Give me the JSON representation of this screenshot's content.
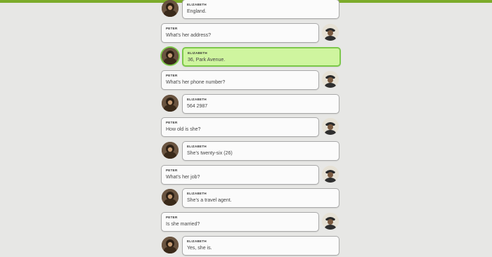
{
  "header": {
    "accent_color": "#7cab2a"
  },
  "dialogue": [
    {
      "speaker": "ELIZABETH",
      "text": "England.",
      "side": "left",
      "active": false
    },
    {
      "speaker": "PETER",
      "text": "What's her address?",
      "side": "right",
      "active": false
    },
    {
      "speaker": "ELIZABETH",
      "text": "36, Park Avenue.",
      "side": "left",
      "active": true
    },
    {
      "speaker": "PETER",
      "text": "What's her phone number?",
      "side": "right",
      "active": false
    },
    {
      "speaker": "ELIZABETH",
      "text": "564 2987",
      "side": "left",
      "active": false
    },
    {
      "speaker": "PETER",
      "text": "How old is she?",
      "side": "right",
      "active": false
    },
    {
      "speaker": "ELIZABETH",
      "text": "She's twenty-six (26)",
      "side": "left",
      "active": false
    },
    {
      "speaker": "PETER",
      "text": "What's her job?",
      "side": "right",
      "active": false
    },
    {
      "speaker": "ELIZABETH",
      "text": "She's a travel agent.",
      "side": "left",
      "active": false
    },
    {
      "speaker": "PETER",
      "text": "Is she married?",
      "side": "right",
      "active": false
    },
    {
      "speaker": "ELIZABETH",
      "text": "Yes, she is.",
      "side": "left",
      "active": false
    }
  ],
  "colors": {
    "active_bubble": "#cff59f",
    "active_border": "#7cc84a",
    "bubble": "#fbfbfb",
    "background": "#e7e7e5"
  }
}
